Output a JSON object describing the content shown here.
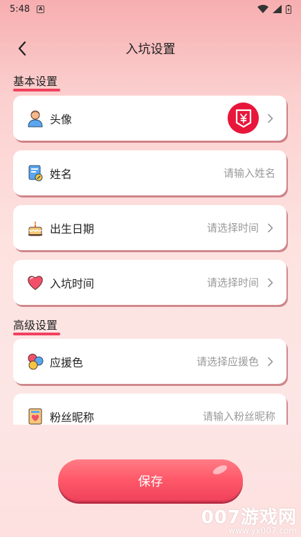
{
  "status_bar": {
    "time": "5:48",
    "notif_letter": "A"
  },
  "header": {
    "title": "入坑设置"
  },
  "sections": {
    "basic": "基本设置",
    "advanced": "高级设置"
  },
  "rows": {
    "avatar": {
      "label": "头像"
    },
    "name": {
      "label": "姓名",
      "placeholder": "请输入姓名"
    },
    "birthday": {
      "label": "出生日期",
      "value": "请选择时间"
    },
    "join_time": {
      "label": "入坑时间",
      "value": "请选择时间"
    },
    "support_color": {
      "label": "应援色",
      "value": "请选择应援色"
    },
    "fan_nickname": {
      "label": "粉丝昵称",
      "placeholder": "请输入粉丝昵称"
    }
  },
  "actions": {
    "save": "保存"
  },
  "watermark": {
    "big": "007游戏网",
    "small": "www.yx007.com"
  },
  "colors": {
    "accent": "#f0415e",
    "avatar_bg": "#e8163b"
  }
}
